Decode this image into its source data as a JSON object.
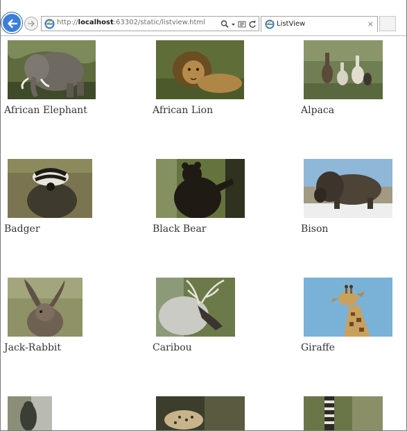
{
  "browser": {
    "url_prefix": "http://",
    "url_host": "localhost",
    "url_rest": ":63302/static/listview.html",
    "tab_title": "ListView",
    "tab_close": "×"
  },
  "animals": [
    {
      "name": "African Elephant",
      "icon": "elephant-photo"
    },
    {
      "name": "African Lion",
      "icon": "lion-photo"
    },
    {
      "name": "Alpaca",
      "icon": "alpaca-photo"
    },
    {
      "name": "Badger",
      "icon": "badger-photo"
    },
    {
      "name": "Black Bear",
      "icon": "black-bear-photo"
    },
    {
      "name": "Bison",
      "icon": "bison-photo"
    },
    {
      "name": "Jack-Rabbit",
      "icon": "jack-rabbit-photo"
    },
    {
      "name": "Caribou",
      "icon": "caribou-photo"
    },
    {
      "name": "Giraffe",
      "icon": "giraffe-photo"
    },
    {
      "name": "",
      "icon": "bird-photo"
    },
    {
      "name": "",
      "icon": "leopard-photo"
    },
    {
      "name": "",
      "icon": "lemur-photo"
    }
  ],
  "colors": {
    "back_button": "#3b7fd6",
    "caption_text": "#333333",
    "page_background": "#ffffff"
  }
}
